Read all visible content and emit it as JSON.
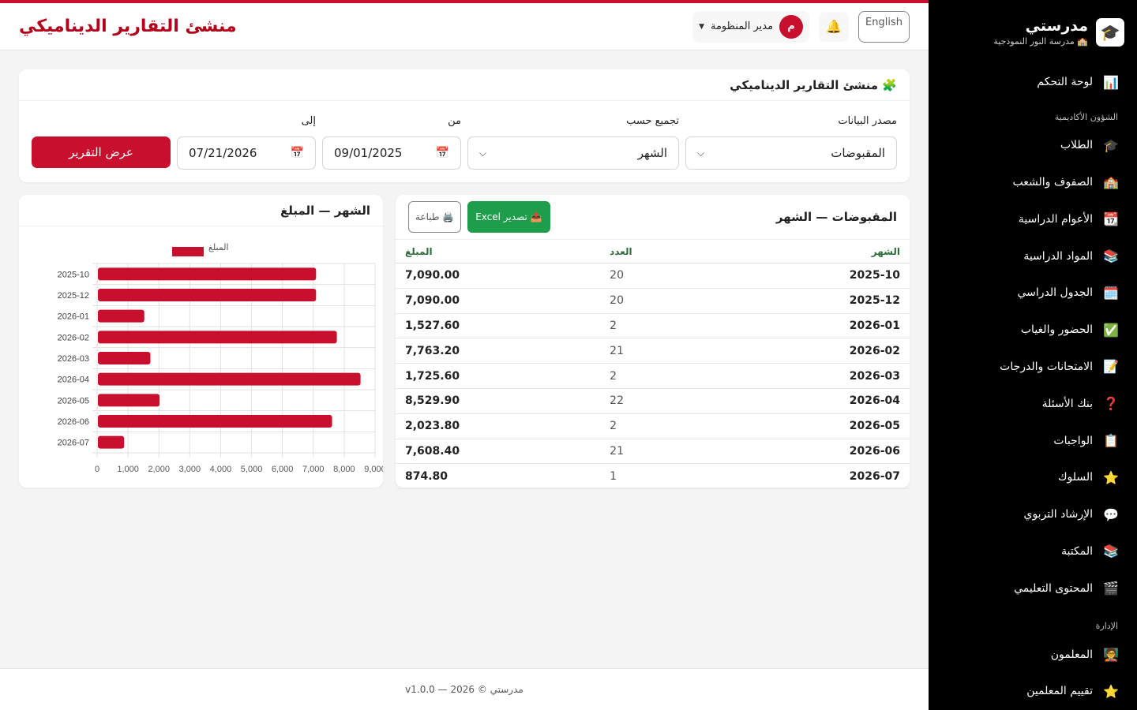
{
  "sidebar": {
    "brand_name": "مدرستي",
    "school_name": "🏫 مدرسة النور النموذجية",
    "logo_icon": "graduation-cap-logo",
    "dashboard": {
      "icon": "📊",
      "label": "لوحة التحكم"
    },
    "section_academic": "الشؤون الأكاديمية",
    "academic_items": [
      {
        "icon": "🎓",
        "label": "الطلاب"
      },
      {
        "icon": "🏫",
        "label": "الصفوف والشعب"
      },
      {
        "icon": "📆",
        "label": "الأعوام الدراسية"
      },
      {
        "icon": "📚",
        "label": "المواد الدراسية"
      },
      {
        "icon": "🗓️",
        "label": "الجدول الدراسي"
      },
      {
        "icon": "✅",
        "label": "الحضور والغياب"
      },
      {
        "icon": "📝",
        "label": "الامتحانات والدرجات"
      },
      {
        "icon": "❓",
        "label": "بنك الأسئلة"
      },
      {
        "icon": "📋",
        "label": "الواجبات"
      },
      {
        "icon": "⭐",
        "label": "السلوك"
      },
      {
        "icon": "💬",
        "label": "الإرشاد التربوي"
      },
      {
        "icon": "📚",
        "label": "المكتبة"
      },
      {
        "icon": "🎬",
        "label": "المحتوى التعليمي"
      }
    ],
    "section_admin": "الإدارة",
    "admin_items": [
      {
        "icon": "🧑‍🏫",
        "label": "المعلمون"
      },
      {
        "icon": "⭐",
        "label": "تقييم المعلمين"
      }
    ]
  },
  "topbar": {
    "title": "منشئ التقارير الديناميكي",
    "language_button": "English",
    "user_name": "مدير المنظومة",
    "avatar_letter": "م"
  },
  "filter_card": {
    "title": "🧩 منشئ التقارير الديناميكي",
    "source_label": "مصدر البيانات",
    "source_value": "المقبوضات",
    "group_label": "تجميع حسب",
    "group_value": "الشهر",
    "from_label": "من",
    "from_value": "09/01/2025",
    "to_label": "إلى",
    "to_value": "07/21/2026",
    "run_button": "عرض التقرير"
  },
  "table_card": {
    "title": "المقبوضات — الشهر",
    "excel_button": "📤 تصدير Excel",
    "print_button": "🖨️ طباعة",
    "columns": [
      "الشهر",
      "العدد",
      "المبلغ"
    ],
    "rows": [
      [
        "2025-10",
        "20",
        "7,090.00"
      ],
      [
        "2025-12",
        "20",
        "7,090.00"
      ],
      [
        "2026-01",
        "2",
        "1,527.60"
      ],
      [
        "2026-02",
        "21",
        "7,763.20"
      ],
      [
        "2026-03",
        "2",
        "1,725.60"
      ],
      [
        "2026-04",
        "22",
        "8,529.90"
      ],
      [
        "2026-05",
        "2",
        "2,023.80"
      ],
      [
        "2026-06",
        "21",
        "7,608.40"
      ],
      [
        "2026-07",
        "1",
        "874.80"
      ]
    ]
  },
  "chart_card": {
    "title": "الشهر — المبلغ"
  },
  "chart_data": {
    "type": "bar",
    "orientation": "horizontal",
    "categories": [
      "2025-10",
      "2025-12",
      "2026-01",
      "2026-02",
      "2026-03",
      "2026-04",
      "2026-05",
      "2026-06",
      "2026-07"
    ],
    "series": [
      {
        "name": "المبلغ",
        "values": [
          7090.0,
          7090.0,
          1527.6,
          7763.2,
          1725.6,
          8529.9,
          2023.8,
          7608.4,
          874.8
        ],
        "color": "#c8102e"
      }
    ],
    "xlim": [
      0,
      9000
    ],
    "xticks": [
      "0",
      "1,000",
      "2,000",
      "3,000",
      "4,000",
      "5,000",
      "6,000",
      "7,000",
      "8,000",
      "9,000"
    ],
    "grid": true,
    "legend": "top-center"
  },
  "footer": {
    "text": "مدرستي © 2026 — v1.0.0"
  },
  "colors": {
    "accent": "#c8102e",
    "title_red": "#b3001b",
    "excel_green": "#1e9e4a",
    "sidebar_bg": "#000000"
  }
}
